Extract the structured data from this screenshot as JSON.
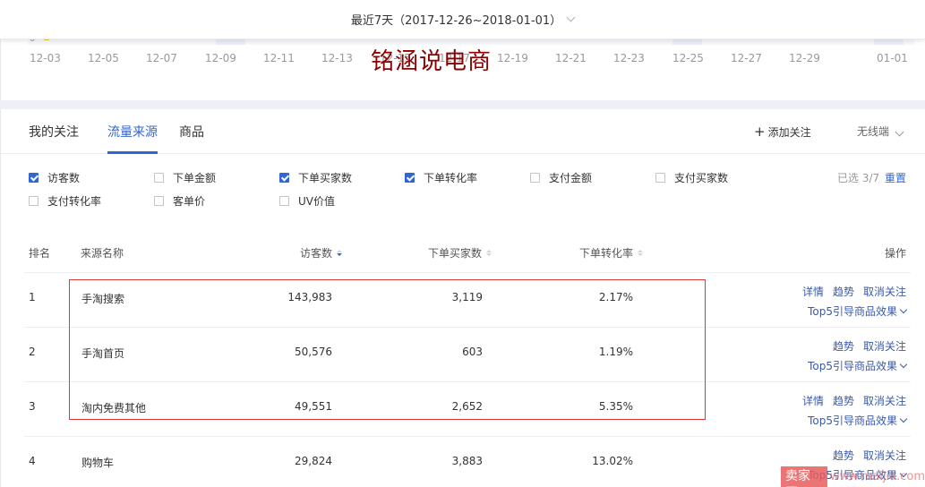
{
  "date_range": {
    "label": "最近7天（2017-12-26~2018-01-01）"
  },
  "chart": {
    "y_zero_label": "0",
    "x_ticks": [
      "12-03",
      "12-05",
      "12-07",
      "12-09",
      "12-11",
      "12-13",
      "12-15",
      "12-17",
      "12-19",
      "12-21",
      "12-23",
      "12-25",
      "12-27",
      "12-29",
      "01-01"
    ]
  },
  "watermark_top": "铭涵说电商",
  "tabs": [
    {
      "label": "我的关注",
      "active": false
    },
    {
      "label": "流量来源",
      "active": true
    },
    {
      "label": "商品",
      "active": false
    }
  ],
  "toolbar": {
    "add_follow_label": "添加关注",
    "device_label": "无线端"
  },
  "metrics": [
    {
      "label": "访客数",
      "checked": true
    },
    {
      "label": "下单金额",
      "checked": false
    },
    {
      "label": "下单买家数",
      "checked": true
    },
    {
      "label": "下单转化率",
      "checked": true
    },
    {
      "label": "支付金额",
      "checked": false
    },
    {
      "label": "支付买家数",
      "checked": false
    },
    {
      "label": "支付转化率",
      "checked": false
    },
    {
      "label": "客单价",
      "checked": false
    },
    {
      "label": "UV价值",
      "checked": false
    }
  ],
  "selection": {
    "count_label": "已选 3/7",
    "reset_label": "重置"
  },
  "table": {
    "headers": {
      "rank": "排名",
      "source": "来源名称",
      "visitors": "访客数",
      "buyers": "下单买家数",
      "conversion": "下单转化率",
      "actions": "操作"
    },
    "sort_active": "visitors",
    "rows": [
      {
        "rank": "1",
        "source": "手淘搜索",
        "visitors": "143,983",
        "buyers": "3,119",
        "conversion": "2.17%",
        "ops": [
          "详情",
          "趋势",
          "取消关注"
        ],
        "top5": "Top5引导商品效果"
      },
      {
        "rank": "2",
        "source": "手淘首页",
        "visitors": "50,576",
        "buyers": "603",
        "conversion": "1.19%",
        "ops": [
          "趋势",
          "取消关注"
        ],
        "top5": "Top5引导商品效果"
      },
      {
        "rank": "3",
        "source": "淘内免费其他",
        "visitors": "49,551",
        "buyers": "2,652",
        "conversion": "5.35%",
        "ops": [
          "详情",
          "趋势",
          "取消关注"
        ],
        "top5": "Top5引导商品效果"
      },
      {
        "rank": "4",
        "source": "购物车",
        "visitors": "29,824",
        "buyers": "3,883",
        "conversion": "13.02%",
        "ops": [
          "趋势",
          "取消关注"
        ],
        "top5": "Top5引导商品效果"
      }
    ]
  },
  "watermark_bottom": {
    "brand": "卖家网",
    "url": "www.maijia.com"
  },
  "colors": {
    "accent": "#2f66d4",
    "highlight_box": "#e0383a",
    "watermark_top": "#8b0000"
  }
}
